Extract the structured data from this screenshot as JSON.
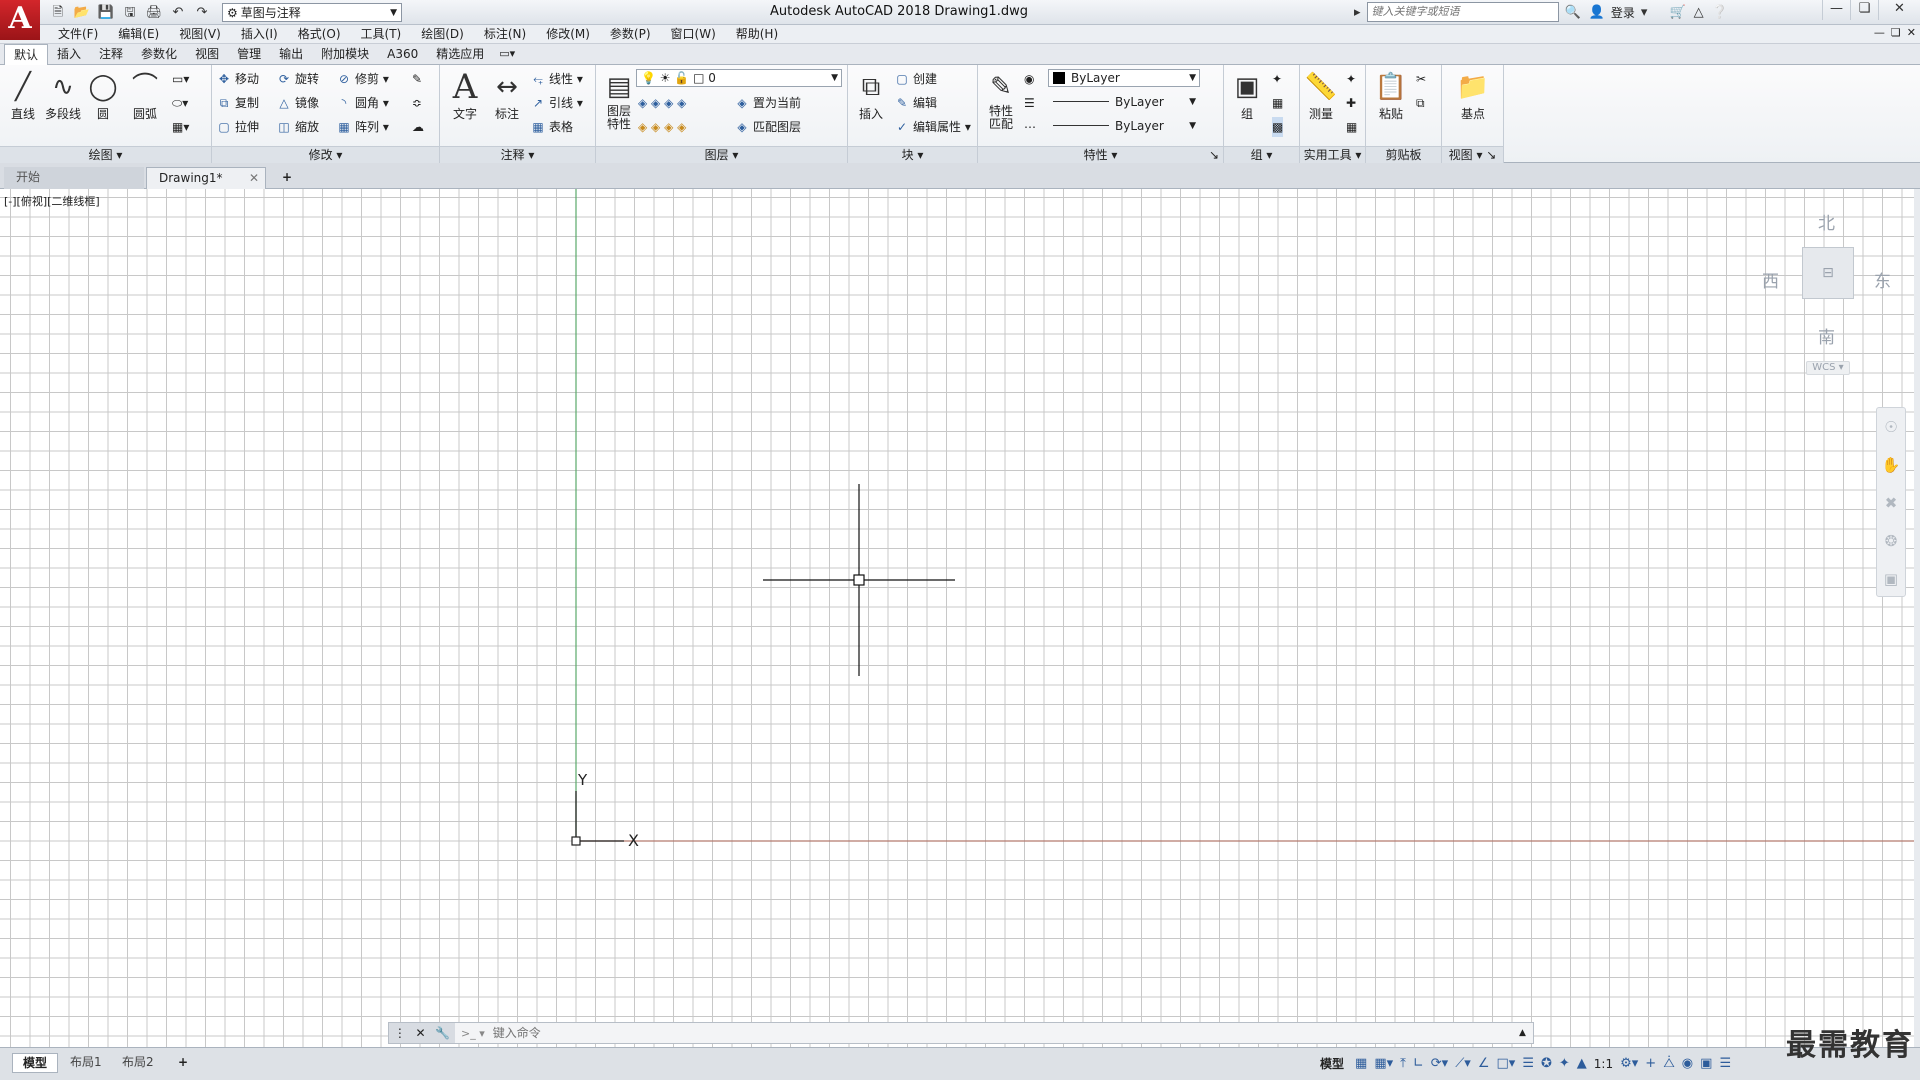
{
  "app": {
    "logo_letter": "A",
    "title": "Autodesk AutoCAD 2018    Drawing1.dwg"
  },
  "quick_access": {
    "icons": [
      "new-icon",
      "open-icon",
      "save-icon",
      "save-as-icon",
      "plot-icon",
      "undo-icon",
      "redo-icon"
    ],
    "workspace": "草图与注释"
  },
  "search": {
    "placeholder": "键入关键字或短语",
    "login": "登录"
  },
  "menu": [
    "文件(F)",
    "编辑(E)",
    "视图(V)",
    "插入(I)",
    "格式(O)",
    "工具(T)",
    "绘图(D)",
    "标注(N)",
    "修改(M)",
    "参数(P)",
    "窗口(W)",
    "帮助(H)"
  ],
  "ribbon_tabs": [
    "默认",
    "插入",
    "注释",
    "参数化",
    "视图",
    "管理",
    "输出",
    "附加模块",
    "A360",
    "精选应用"
  ],
  "ribbon": {
    "draw": {
      "title": "绘图",
      "line": "直线",
      "polyline": "多段线",
      "circle": "圆",
      "arc": "圆弧"
    },
    "modify": {
      "title": "修改",
      "move": "移动",
      "rotate": "旋转",
      "trim": "修剪",
      "copy": "复制",
      "mirror": "镜像",
      "fillet": "圆角",
      "stretch": "拉伸",
      "scale": "缩放",
      "array": "阵列"
    },
    "annotation": {
      "title": "注释",
      "text": "文字",
      "dimension": "标注",
      "linear": "线性",
      "leader": "引线",
      "table": "表格"
    },
    "layers": {
      "title": "图层",
      "properties": "图层\n特性",
      "current_layer": "0",
      "make_current": "置为当前",
      "match_layer": "匹配图层"
    },
    "block": {
      "title": "块",
      "insert": "插入",
      "create": "创建",
      "edit": "编辑",
      "edit_attr": "编辑属性"
    },
    "properties": {
      "title": "特性",
      "match": "特性\n匹配",
      "color": "ByLayer",
      "lineweight": "ByLayer",
      "linetype": "ByLayer"
    },
    "groups": {
      "title": "组",
      "group": "组"
    },
    "utilities": {
      "title": "实用工具",
      "measure": "测量"
    },
    "clipboard": {
      "title": "剪贴板",
      "paste": "粘贴"
    },
    "view": {
      "title": "视图",
      "base": "基点"
    }
  },
  "file_tabs": {
    "start": "开始",
    "drawing": "Drawing1*"
  },
  "viewport": {
    "label": "[-][俯视][二维线框]",
    "compass": {
      "north": "北",
      "south": "南",
      "east": "东",
      "west": "西"
    },
    "wcs": "WCS",
    "ucs": {
      "x": "X",
      "y": "Y"
    }
  },
  "command": {
    "placeholder": "键入命令"
  },
  "layout_tabs": {
    "model": "模型",
    "layout1": "布局1",
    "layout2": "布局2"
  },
  "status": {
    "model": "模型",
    "scale": "1:1"
  },
  "watermark": "最需教育",
  "colors": {
    "grid": "#c8c8c8",
    "x_axis": "#b47a6e",
    "y_axis": "#5aa96a",
    "accent": "#c8272d"
  }
}
